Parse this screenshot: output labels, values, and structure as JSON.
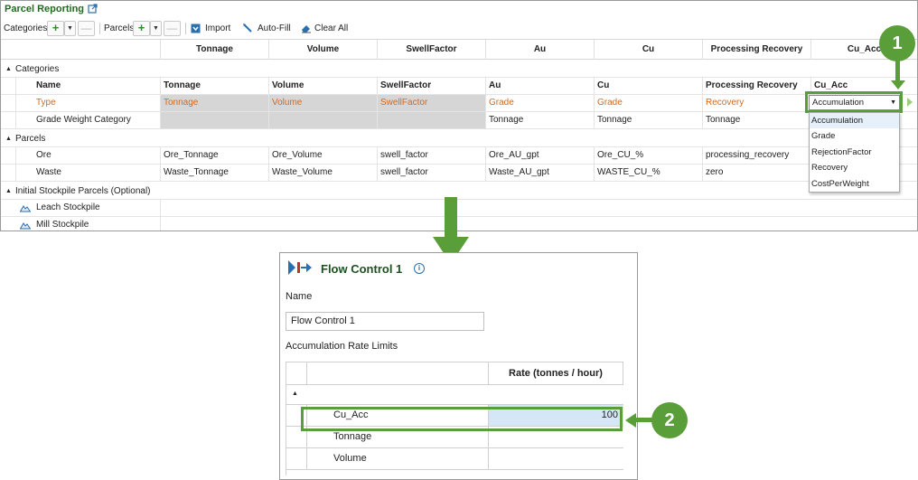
{
  "top_panel": {
    "title": "Parcel Reporting",
    "toolbar": {
      "categories_label": "Categories",
      "parcels_label": "Parcels",
      "plus": "+",
      "minus": "—",
      "caret": "▼",
      "import_label": "Import",
      "autofill_label": "Auto-Fill",
      "clearall_label": "Clear All"
    },
    "columns": [
      "Tonnage",
      "Volume",
      "SwellFactor",
      "Au",
      "Cu",
      "Processing Recovery",
      "Cu_Acc"
    ],
    "categories_group": "Categories",
    "name_header": "Name",
    "type_row": {
      "label": "Type",
      "values": [
        "Tonnage",
        "Volume",
        "SwellFactor",
        "Grade",
        "Grade",
        "Recovery"
      ],
      "cu_acc_selected": "Accumulation"
    },
    "grade_weight_row": {
      "label": "Grade Weight Category",
      "values": [
        "",
        "",
        "",
        "Tonnage",
        "Tonnage",
        "Tonnage"
      ]
    },
    "parcels_group": "Parcels",
    "parcels": [
      {
        "name": "Ore",
        "values": [
          "Ore_Tonnage",
          "Ore_Volume",
          "swell_factor",
          "Ore_AU_gpt",
          "Ore_CU_%",
          "processing_recovery"
        ]
      },
      {
        "name": "Waste",
        "values": [
          "Waste_Tonnage",
          "Waste_Volume",
          "swell_factor",
          "Waste_AU_gpt",
          "WASTE_CU_%",
          "zero"
        ]
      }
    ],
    "stockpile_group": "Initial Stockpile Parcels (Optional)",
    "stockpiles": [
      "Leach Stockpile",
      "Mill Stockpile"
    ],
    "dropdown_options": [
      "Accumulation",
      "Grade",
      "RejectionFactor",
      "Recovery",
      "CostPerWeight"
    ],
    "caret": "▼"
  },
  "callouts": {
    "one": "1",
    "two": "2"
  },
  "flow_panel": {
    "title": "Flow Control 1",
    "info": "i",
    "name_label": "Name",
    "name_value": "Flow Control 1",
    "limits_label": "Accumulation Rate Limits",
    "rate_header": "Rate (tonnes / hour)",
    "rows": [
      {
        "name": "Cu_Acc",
        "rate": "100"
      },
      {
        "name": "Tonnage",
        "rate": ""
      },
      {
        "name": "Volume",
        "rate": ""
      }
    ]
  },
  "colors": {
    "accent_green": "#5a9e3a",
    "orange_text": "#d2691e",
    "title_green": "#1f6b1f"
  }
}
